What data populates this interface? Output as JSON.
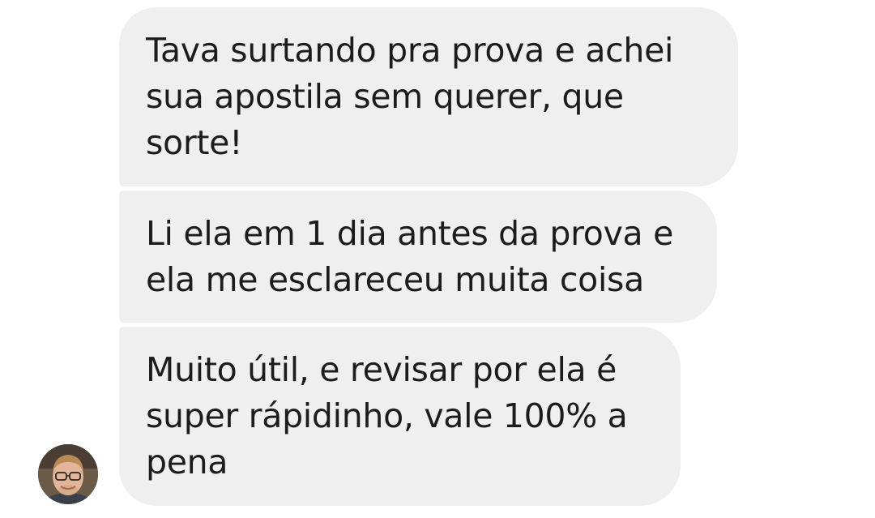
{
  "messages": [
    {
      "text": "Tava surtando pra prova e achei\nsua apostila sem querer, que\nsorte!"
    },
    {
      "text": "Li ela em 1 dia antes da prova e\nela me esclareceu muita coisa"
    },
    {
      "text": "Muito útil, e revisar por ela é\nsuper rápidinho, vale 100% a\npena"
    }
  ],
  "sender": {
    "avatar": "avatar-photo"
  },
  "colors": {
    "bubble": "#efefef",
    "text": "#1c1c1c",
    "background": "#ffffff"
  }
}
